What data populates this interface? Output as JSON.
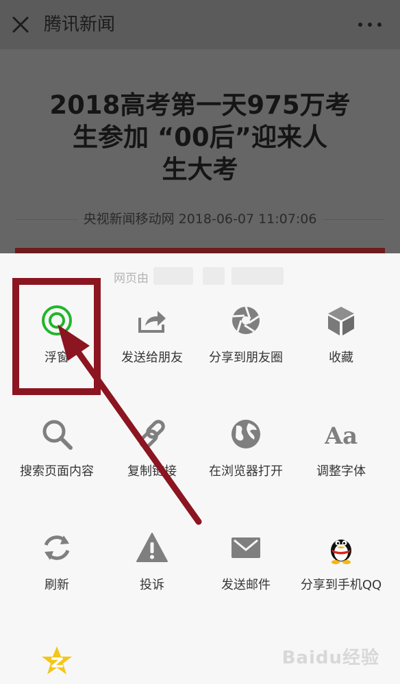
{
  "header": {
    "title": "腾讯新闻",
    "close_icon": "close-icon",
    "more_icon": "more-icon"
  },
  "article": {
    "title_line1": "2018高考第一天975万考",
    "title_line2": "生参加 “00后”迎来人",
    "title_line3": "生大考",
    "meta": "央视新闻移动网 2018-06-07 11:07:06"
  },
  "sheet": {
    "provider": "网页由",
    "items": [
      {
        "label": "浮窗",
        "icon": "floating-window-icon"
      },
      {
        "label": "发送给朋友",
        "icon": "share-arrow-icon"
      },
      {
        "label": "分享到朋友圈",
        "icon": "moments-aperture-icon"
      },
      {
        "label": "收藏",
        "icon": "favorite-cube-icon"
      },
      {
        "label": "搜索页面内容",
        "icon": "search-icon"
      },
      {
        "label": "复制链接",
        "icon": "link-icon"
      },
      {
        "label": "在浏览器打开",
        "icon": "browser-globe-icon"
      },
      {
        "label": "调整字体",
        "icon": "font-size-icon",
        "glyph": "Aa"
      },
      {
        "label": "刷新",
        "icon": "refresh-icon"
      },
      {
        "label": "投诉",
        "icon": "warning-icon"
      },
      {
        "label": "发送邮件",
        "icon": "mail-icon"
      },
      {
        "label": "分享到手机QQ",
        "icon": "qq-penguin-icon"
      },
      {
        "label": "",
        "icon": "qzone-star-icon"
      }
    ]
  },
  "annotation": {
    "color": "#8b1520"
  },
  "watermark": {
    "text": "Baidu经验"
  },
  "colors": {
    "accent_green": "#21b62a",
    "icon_gray": "#7f7f7f",
    "qzone_yellow": "#f5c518"
  }
}
